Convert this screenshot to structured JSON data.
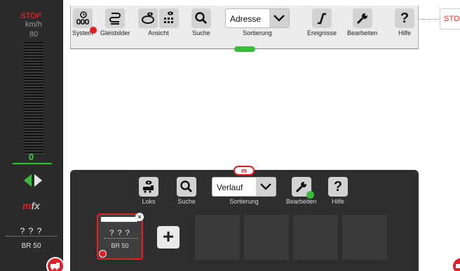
{
  "left_panel": {
    "stop": "STOP",
    "unit": "km/h",
    "max_speed": "80",
    "speed_value": "0",
    "speed_fraction": 0.0,
    "loco_name": "? ? ?",
    "loco_type": "BR 50"
  },
  "top_toolbar": {
    "system_label": "System",
    "gleisbilder_label": "Gleisbilder",
    "ansicht_label": "Ansicht",
    "suche_label": "Suche",
    "sort_value": "Adresse",
    "sort_label": "Sortierung",
    "ereignisse_label": "Ereignisse",
    "bearbeiten_label": "Bearbeiten",
    "hilfe_label": "Hilfe"
  },
  "right_panel": {
    "stop": "STO"
  },
  "bottom_panel": {
    "tab_label": "m",
    "loks_label": "Loks",
    "suche_label": "Suche",
    "sort_value": "Verlauf",
    "sort_label": "Sortierung",
    "bearbeiten_label": "Bearbeiten",
    "hilfe_label": "Hilfe",
    "loco_card_name": "? ? ?",
    "loco_card_type": "BR 50",
    "add_label": "+"
  },
  "icons": {
    "system": "clock-grid-icon",
    "gleisbilder": "track-layout-icon",
    "ansicht": "eye-view-icon",
    "suche": "magnifier-icon",
    "ereignisse": "event-curve-icon",
    "bearbeiten": "wrench-icon",
    "hilfe": "question-icon"
  },
  "colors": {
    "accent_green": "#3dbb3d",
    "stop_red": "#ff2a2a",
    "brand_red": "#e21e26"
  }
}
